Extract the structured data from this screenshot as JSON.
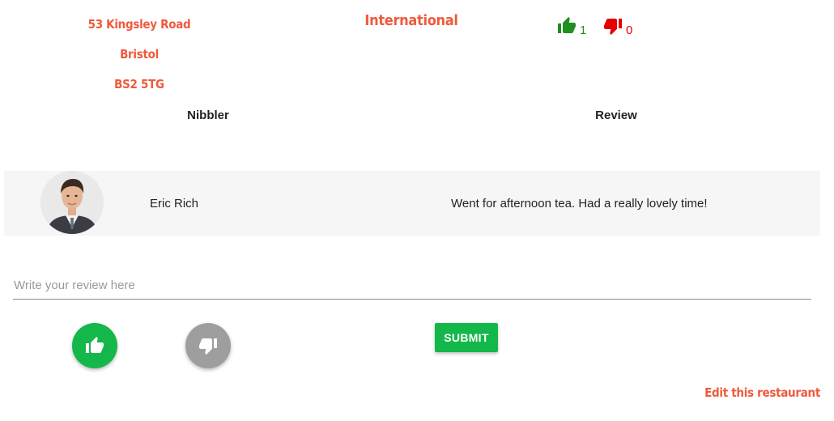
{
  "restaurant": {
    "address_line1": "53 Kingsley Road",
    "address_line2": "Bristol",
    "address_line3": "BS2 5TG",
    "cuisine": "International",
    "thumbs_up_count": "1",
    "thumbs_down_count": "0"
  },
  "reviews_table": {
    "headers": [
      "Nibbler",
      "Review"
    ],
    "rows": [
      {
        "nibbler": "Eric Rich",
        "review": "Went for afternoon tea. Had a really lovely time!"
      }
    ]
  },
  "review_form": {
    "placeholder": "Write your review here",
    "value": "",
    "submit_label": "SUBMIT"
  },
  "edit_link": "Edit this restaurant",
  "icons": {
    "thumbs_up": "thumbs-up-icon",
    "thumbs_down": "thumbs-down-icon"
  },
  "colors": {
    "accent": "#ef5a3c",
    "positive": "#14b84a",
    "negative": "#e60000",
    "neutral": "#9e9e9e"
  }
}
